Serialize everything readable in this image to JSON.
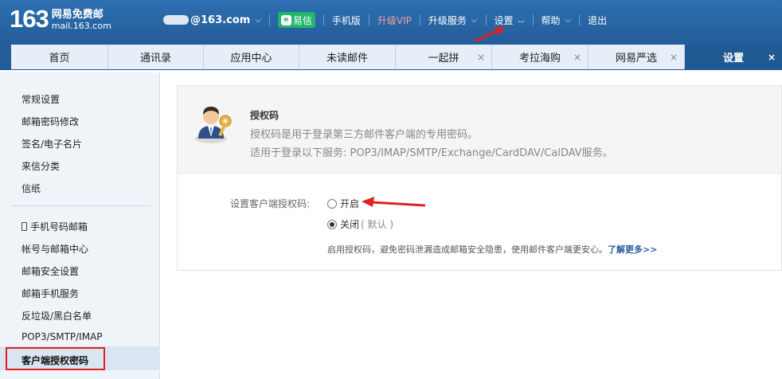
{
  "header": {
    "logo_number": "163",
    "logo_line1": "网易免费邮",
    "logo_line2": "mail.163.com",
    "user_email": "@163.com",
    "yixin_label": "易信",
    "links": [
      "手机版",
      "升级VIP",
      "升级服务",
      "设置",
      "帮助",
      "退出"
    ]
  },
  "tabs": [
    {
      "label": "首页"
    },
    {
      "label": "通讯录"
    },
    {
      "label": "应用中心"
    },
    {
      "label": "未读邮件"
    },
    {
      "label": "一起拼",
      "close": "×"
    },
    {
      "label": "考拉海购",
      "close": "×"
    },
    {
      "label": "网易严选",
      "close": "×"
    },
    {
      "label": "设置",
      "close": "×"
    }
  ],
  "sidebar": {
    "group1": [
      "常规设置",
      "邮箱密码修改",
      "签名/电子名片",
      "来信分类",
      "信纸"
    ],
    "group2": [
      "手机号码邮箱",
      "帐号与邮箱中心",
      "邮箱安全设置",
      "邮箱手机服务",
      "反垃圾/黑白名单",
      "POP3/SMTP/IMAP"
    ],
    "active": "客户端授权密码"
  },
  "content": {
    "title": "授权码",
    "desc1": "授权码是用于登录第三方邮件客户端的专用密码。",
    "desc2": "适用于登录以下服务: POP3/IMAP/SMTP/Exchange/CardDAV/CalDAV服务。",
    "setting_label": "设置客户端授权码:",
    "option_on": "开启",
    "option_off": "关闭",
    "option_off_default": "( 默认 )",
    "note": "启用授权码，避免密码泄漏造成邮箱安全隐患，使用邮件客户端更安心。",
    "learn_more": "了解更多>>"
  },
  "colors": {
    "header_blue": "#2d6fb0",
    "tab_active": "#1f5a93",
    "highlight_red": "#e02020",
    "yixin_green": "#21b66b"
  }
}
